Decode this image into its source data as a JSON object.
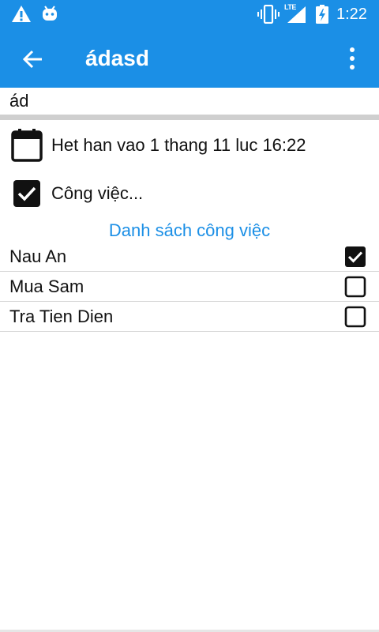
{
  "status_bar": {
    "time": "1:22",
    "network": "LTE",
    "icons": [
      "warning-icon",
      "android-icon",
      "vibrate-icon",
      "signal-icon",
      "battery-charging-icon"
    ]
  },
  "toolbar": {
    "title": "ádasd",
    "back_icon": "arrow-left-icon",
    "menu_icon": "more-vert-icon",
    "color": "#1b8fe6"
  },
  "form": {
    "name_value": "ád",
    "deadline": "Het han vao 1 thang 11 luc 16:22",
    "tasks_label": "Công việc...",
    "tasks_checked": true
  },
  "task_list": {
    "header": "Danh sách công việc",
    "items": [
      {
        "name": "Nau An",
        "checked": true
      },
      {
        "name": "Mua Sam",
        "checked": false
      },
      {
        "name": "Tra Tien Dien",
        "checked": false
      }
    ]
  }
}
